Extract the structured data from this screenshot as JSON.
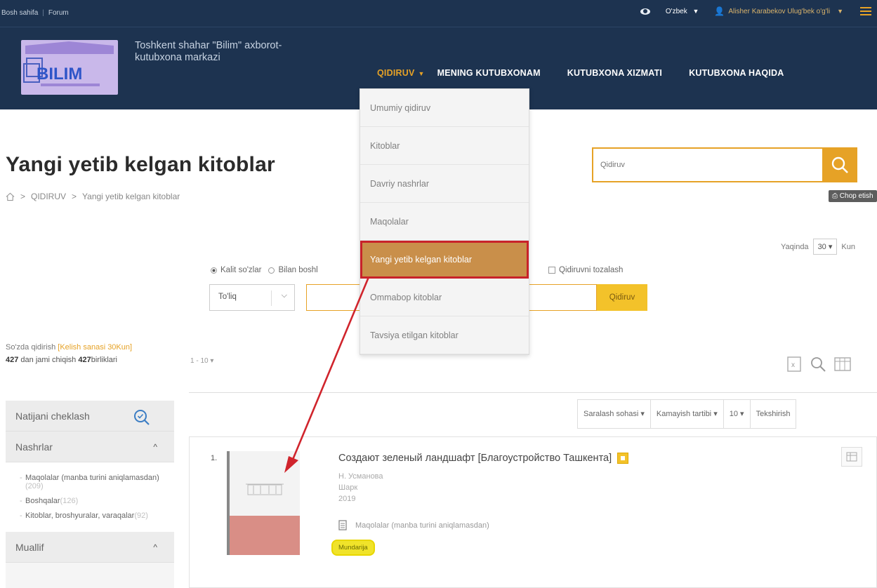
{
  "topbar": {
    "links": [
      "Bosh sahifa",
      "Forum"
    ],
    "language": "O'zbek",
    "user": "Alisher Karabekov Ulug'bek o'g'li"
  },
  "header": {
    "logo_text": "BILIM",
    "org_name": "Toshkent shahar \"Bilim\" axborot-kutubxona markazi",
    "nav": [
      {
        "label": "QIDIRUV"
      },
      {
        "label": "MENING KUTUBXONAM"
      },
      {
        "label": "KUTUBXONA XIZMATI"
      },
      {
        "label": "KUTUBXONA HAQIDA"
      }
    ]
  },
  "dropdown": {
    "items": [
      "Umumiy qidiruv",
      "Kitoblar",
      "Davriy nashrlar",
      "Maqolalar",
      "Yangi yetib kelgan kitoblar",
      "Ommabop kitoblar",
      "Tavsiya etilgan kitoblar"
    ],
    "selected_index": 4
  },
  "page": {
    "title": "Yangi yetib kelgan kitoblar",
    "breadcrumb": [
      "QIDIRUV",
      "Yangi yetib kelgan kitoblar"
    ]
  },
  "search_top": {
    "placeholder": "Qidiruv",
    "print_label": "Chop etish"
  },
  "recent": {
    "label": "Yaqinda",
    "days": "30",
    "unit": "Kun"
  },
  "search_options": {
    "radio_keywords": "Kalit so'zlar",
    "radio_starts": "Bilan boshl",
    "clear_label": "Qidiruvni tozalash",
    "mode": "To'liq",
    "button": "Qidiruv"
  },
  "results_info": {
    "search_in": "So'zda qidirish",
    "filter": "[Kelish sanasi 30Kun]",
    "total_prefix": "427",
    "total_mid": " dan jami chiqish ",
    "total_bold": "427",
    "total_suffix": "birliklari",
    "range": "1 - 10"
  },
  "sortbar": {
    "field": "Saralash sohasi",
    "order": "Kamayish tartibi",
    "per_page": "10",
    "check": "Tekshirish"
  },
  "sidebar": {
    "title": "Natijani cheklash",
    "sections": [
      {
        "title": "Nashrlar",
        "items": [
          {
            "label": "Maqolalar (manba turini aniqlamasdan)",
            "count": "(209)"
          },
          {
            "label": "Boshqalar",
            "count": "(126)"
          },
          {
            "label": "Kitoblar, broshyuralar, varaqalar",
            "count": "(92)"
          }
        ]
      },
      {
        "title": "Muallif"
      }
    ]
  },
  "result": {
    "index": "1.",
    "title": "Создают зеленый ландшафт [Благоустройство Ташкента]",
    "author": "Н. Усманова",
    "source": "Шарк",
    "year": "2019",
    "type": "Maqolalar (manba turini aniqlamasdan)",
    "contents_label": "Mundarija"
  },
  "colors": {
    "header_bg": "#1d3350",
    "accent": "#e6a226",
    "selected_item": "#c98f4a",
    "highlight_red": "#c8222a"
  }
}
